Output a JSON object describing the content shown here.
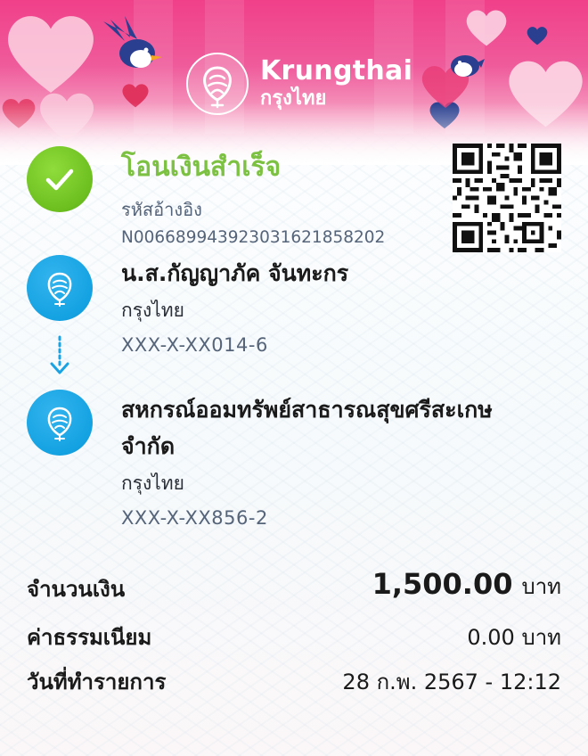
{
  "colors": {
    "success_green": "#7cc142",
    "bank_blue": "#14a2e2",
    "banner_pink": "#ef4f93",
    "secondary_text": "#56647a"
  },
  "header": {
    "brand_name": "Krungthai",
    "brand_name_thai": "กรุงไทย",
    "logo_icon": "krungthai-bird-logo"
  },
  "status": {
    "icon": "check-icon",
    "title": "โอนเงินสำเร็จ",
    "reference_label": "รหัสอ้างอิง",
    "reference_number": "N006689943923031621858202",
    "qr_icon": "qr-code"
  },
  "sender": {
    "name": "น.ส.กัญญาภัค จันทะกร",
    "bank": "กรุงไทย",
    "account": "XXX-X-XX014-6",
    "icon": "krungthai-bank-icon"
  },
  "transfer_arrow_icon": "arrow-down-icon",
  "recipient": {
    "name_line1": "สหกรณ์ออมทรัพย์สาธารณสุขศรีสะเกษ",
    "name_line2": "จำกัด",
    "bank": "กรุงไทย",
    "account": "XXX-X-XX856-2",
    "icon": "krungthai-bank-icon"
  },
  "summary": {
    "amount_label": "จำนวนเงิน",
    "amount_value": "1,500.00",
    "amount_unit": "บาท",
    "fee_label": "ค่าธรรมเนียม",
    "fee_value": "0.00 บาท",
    "date_label": "วันที่ทำรายการ",
    "date_value": "28 ก.พ. 2567 - 12:12"
  }
}
